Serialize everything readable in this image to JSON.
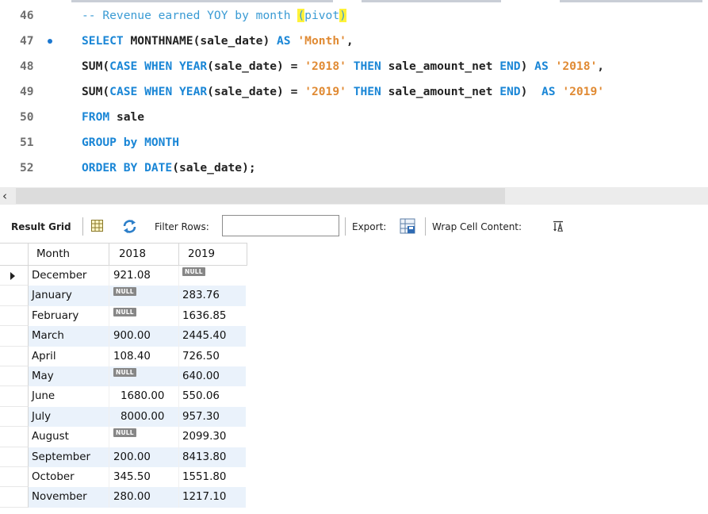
{
  "editor": {
    "lines": [
      {
        "num": "46",
        "text": "-- Revenue earned YOY by month (pivot)"
      },
      {
        "num": "47",
        "text": "SELECT MONTHNAME(sale_date) AS 'Month',"
      },
      {
        "num": "48",
        "text": "SUM(CASE WHEN YEAR(sale_date) = '2018' THEN sale_amount_net END) AS '2018',"
      },
      {
        "num": "49",
        "text": "SUM(CASE WHEN YEAR(sale_date) = '2019' THEN sale_amount_net END)  AS '2019'"
      },
      {
        "num": "50",
        "text": "FROM sale"
      },
      {
        "num": "51",
        "text": "GROUP by MONTH"
      },
      {
        "num": "52",
        "text": "ORDER BY DATE(sale_date);"
      }
    ],
    "colors": {
      "keyword": "#1a86d6",
      "string": "#e08a33",
      "comment": "#3a9bd4",
      "highlight": "#fff23a",
      "breakpoint_dot": "#1c78d0"
    }
  },
  "scrollbar": {
    "left_arrow": "‹"
  },
  "toolbar": {
    "result_grid_label": "Result Grid",
    "filter_label": "Filter Rows:",
    "filter_value": "",
    "export_label": "Export:",
    "wrap_label": "Wrap Cell Content:",
    "icons": [
      "grid-view-icon",
      "refresh-icon",
      "export-icon",
      "wrap-cell-icon"
    ]
  },
  "grid": {
    "columns": [
      "Month",
      "2018",
      "2019"
    ],
    "null_text": "NULL",
    "rows": [
      {
        "month": "December",
        "y2018": "921.08",
        "y2019": null
      },
      {
        "month": "January",
        "y2018": null,
        "y2019": "283.76"
      },
      {
        "month": "February",
        "y2018": null,
        "y2019": "1636.85"
      },
      {
        "month": "March",
        "y2018": "900.00",
        "y2019": "2445.40"
      },
      {
        "month": "April",
        "y2018": "108.40",
        "y2019": "726.50"
      },
      {
        "month": "May",
        "y2018": null,
        "y2019": "640.00"
      },
      {
        "month": "June",
        "y2018": "1680.00",
        "y2019": "550.06"
      },
      {
        "month": "July",
        "y2018": "8000.00",
        "y2019": "957.30"
      },
      {
        "month": "August",
        "y2018": null,
        "y2019": "2099.30"
      },
      {
        "month": "September",
        "y2018": "200.00",
        "y2019": "8413.80"
      },
      {
        "month": "October",
        "y2018": "345.50",
        "y2019": "1551.80"
      },
      {
        "month": "November",
        "y2018": "280.00",
        "y2019": "1217.10"
      }
    ]
  }
}
